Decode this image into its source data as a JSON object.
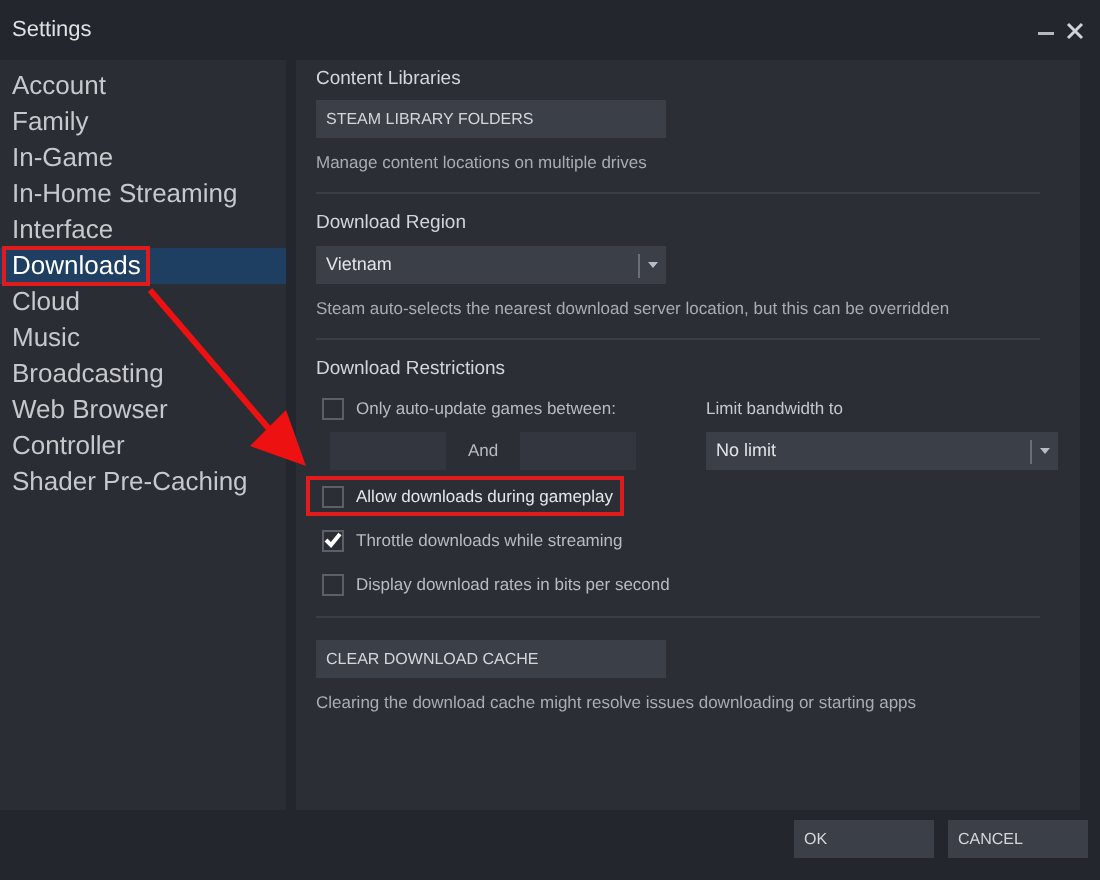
{
  "window": {
    "title": "Settings"
  },
  "sidebar": {
    "items": [
      {
        "label": "Account",
        "selected": false,
        "highlighted": false
      },
      {
        "label": "Family",
        "selected": false,
        "highlighted": false
      },
      {
        "label": "In-Game",
        "selected": false,
        "highlighted": false
      },
      {
        "label": "In-Home Streaming",
        "selected": false,
        "highlighted": false
      },
      {
        "label": "Interface",
        "selected": false,
        "highlighted": false
      },
      {
        "label": "Downloads",
        "selected": true,
        "highlighted": true
      },
      {
        "label": "Cloud",
        "selected": false,
        "highlighted": false
      },
      {
        "label": "Music",
        "selected": false,
        "highlighted": false
      },
      {
        "label": "Broadcasting",
        "selected": false,
        "highlighted": false
      },
      {
        "label": "Web Browser",
        "selected": false,
        "highlighted": false
      },
      {
        "label": "Controller",
        "selected": false,
        "highlighted": false
      },
      {
        "label": "Shader Pre-Caching",
        "selected": false,
        "highlighted": false
      }
    ]
  },
  "content_libraries": {
    "heading": "Content Libraries",
    "button": "STEAM LIBRARY FOLDERS",
    "description": "Manage content locations on multiple drives"
  },
  "download_region": {
    "heading": "Download Region",
    "value": "Vietnam",
    "description": "Steam auto-selects the nearest download server location, but this can be overridden"
  },
  "download_restrictions": {
    "heading": "Download Restrictions",
    "auto_update": {
      "label": "Only auto-update games between:",
      "checked": false,
      "joiner": "And"
    },
    "bandwidth": {
      "label": "Limit bandwidth to",
      "value": "No limit"
    },
    "options": [
      {
        "label": "Allow downloads during gameplay",
        "checked": false,
        "highlighted": true
      },
      {
        "label": "Throttle downloads while streaming",
        "checked": true,
        "highlighted": false
      },
      {
        "label": "Display download rates in bits per second",
        "checked": false,
        "highlighted": false
      }
    ]
  },
  "cache": {
    "button": "CLEAR DOWNLOAD CACHE",
    "description": "Clearing the download cache might resolve issues downloading or starting apps"
  },
  "buttons": [
    "OK",
    "CANCEL"
  ]
}
